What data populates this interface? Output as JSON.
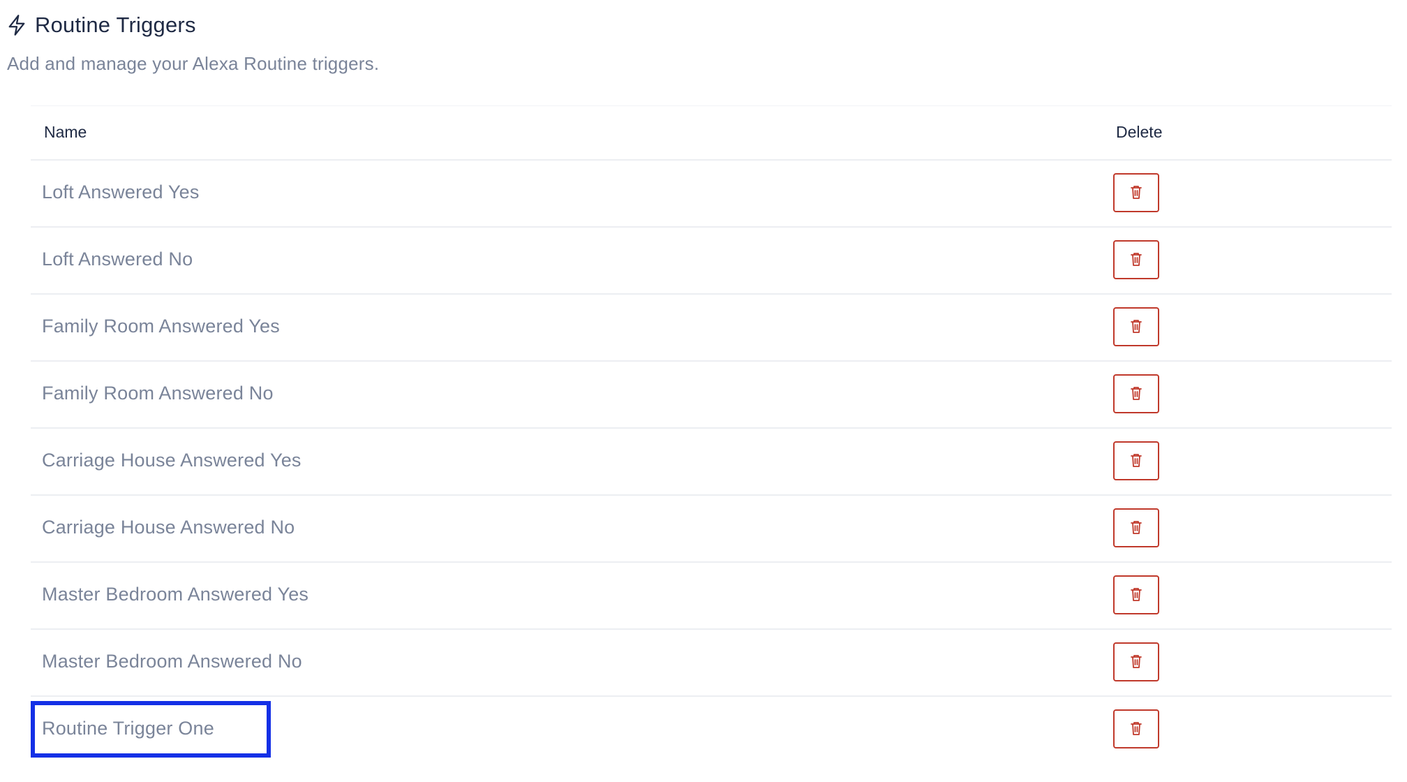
{
  "header": {
    "title": "Routine Triggers",
    "subtitle": "Add and manage your Alexa Routine triggers.",
    "icon": "lightning-bolt-icon"
  },
  "table": {
    "columns": {
      "name": "Name",
      "delete": "Delete"
    },
    "rows": [
      {
        "name": "Loft Answered Yes"
      },
      {
        "name": "Loft Answered No"
      },
      {
        "name": "Family Room Answered Yes"
      },
      {
        "name": "Family Room Answered No"
      },
      {
        "name": "Carriage House Answered Yes"
      },
      {
        "name": "Carriage House Answered No"
      },
      {
        "name": "Master Bedroom Answered Yes"
      },
      {
        "name": "Master Bedroom Answered No"
      },
      {
        "name": "Routine Trigger One"
      }
    ],
    "delete_icon": "trash-icon"
  },
  "colors": {
    "title": "#1f2a44",
    "muted_text": "#7a8499",
    "delete_accent": "#c0392b",
    "highlight": "#1430e6"
  }
}
